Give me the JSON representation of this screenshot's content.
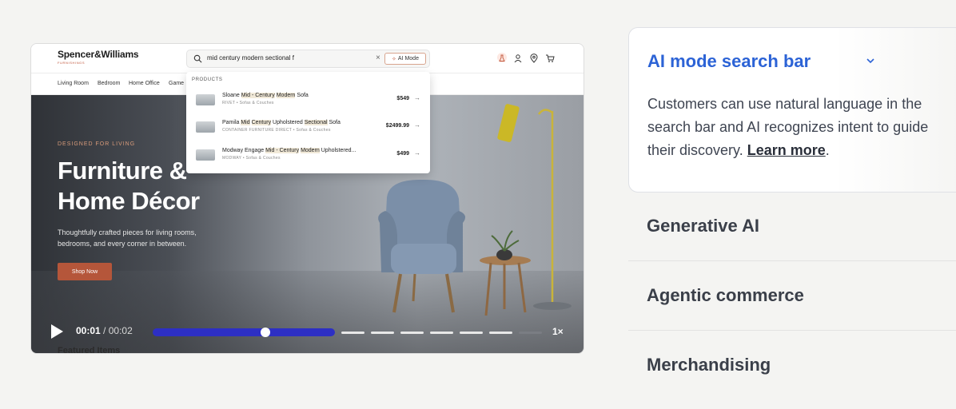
{
  "site": {
    "logo": "Spencer&Williams",
    "logo_sub": "FURNISHINGS",
    "search_query": "mid century modern sectional f",
    "ai_mode_label": "AI Mode",
    "nav": [
      "Living Room",
      "Bedroom",
      "Home Office",
      "Game"
    ]
  },
  "dropdown": {
    "label": "PRODUCTS",
    "items": [
      {
        "name_parts": [
          "Sloane ",
          "Mid - Century",
          " ",
          "Modern",
          " Sofa"
        ],
        "meta": "RIVET  •  Sofas & Couches",
        "price": "$549"
      },
      {
        "name_parts": [
          "Pamila ",
          "Mid",
          " ",
          "Century",
          " Upholstered ",
          "Sectional",
          " Sofa"
        ],
        "meta": "CONTAINER FURNITURE DIRECT  •  Sofas & Couches",
        "price": "$2499.99"
      },
      {
        "name_parts": [
          "Modway Engage ",
          "Mid - Century",
          " ",
          "Modern",
          " Upholstered..."
        ],
        "meta": "MODWAY  •  Sofas & Couches",
        "price": "$499"
      }
    ]
  },
  "hero": {
    "eyebrow": "DESIGNED FOR LIVING",
    "title_line1": "Furniture &",
    "title_line2": "Home Décor",
    "subtitle": "Thoughtfully crafted pieces for living rooms, bedrooms, and every corner in between.",
    "cta": "Shop Now",
    "featured": "Featured Items"
  },
  "player": {
    "current_time": "00:01",
    "separator": " / ",
    "total_time": "00:02",
    "progress_fraction": 0.62,
    "speed": "1×"
  },
  "accordion": {
    "active": {
      "title": "AI mode search bar",
      "desc_before": "Customers can use natural language in the search bar and AI recognizes intent to guide their discovery. ",
      "link": "Learn more",
      "desc_after": "."
    },
    "items": [
      "Generative AI",
      "Agentic commerce",
      "Merchandising"
    ]
  },
  "colors": {
    "accent": "#2c63d6",
    "progress": "#2d2fc4",
    "cta": "#b5563a"
  }
}
